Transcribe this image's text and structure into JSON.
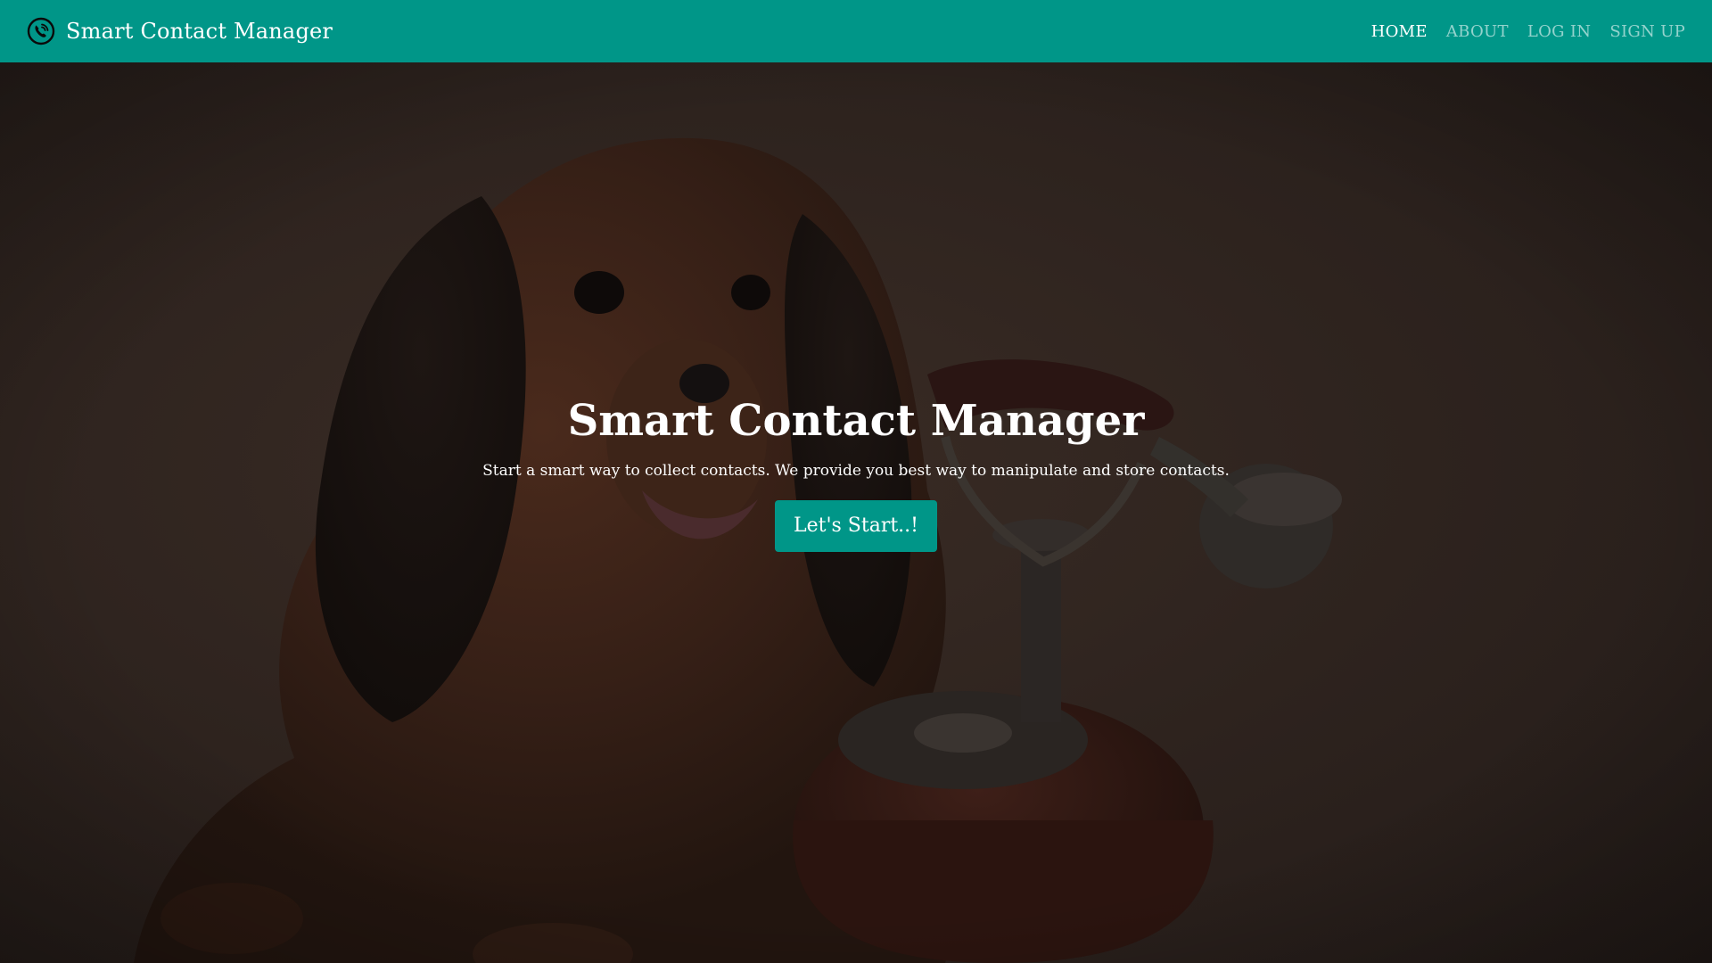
{
  "header": {
    "brand": {
      "icon": "phone-call-icon",
      "title": "Smart Contact Manager"
    },
    "nav": [
      {
        "label": "HOME",
        "active": true
      },
      {
        "label": "ABOUT",
        "active": false
      },
      {
        "label": "LOG IN",
        "active": false
      },
      {
        "label": "SIGN UP",
        "active": false
      }
    ]
  },
  "hero": {
    "background": "dog-and-rotary-phone-photo",
    "title": "Smart Contact Manager",
    "subtitle": "Start a smart way to collect contacts. We provide you best way to manipulate and store contacts.",
    "button_label": "Let's Start..!"
  },
  "colors": {
    "primary": "#009688",
    "overlay": "#2b211d",
    "text": "#ffffff"
  }
}
